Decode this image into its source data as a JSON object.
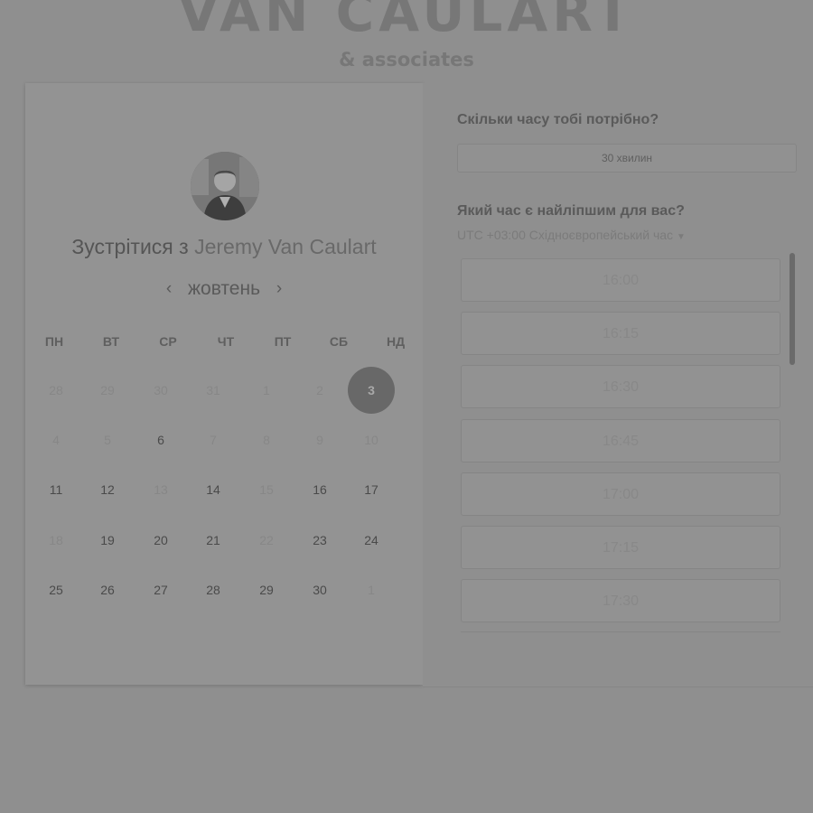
{
  "brand": {
    "title": "VAN CAULART",
    "subtitle": "& associates"
  },
  "meeting": {
    "prefix": "Зустрітися з",
    "name": "Jeremy Van Caulart"
  },
  "calendar": {
    "month": "жовтень",
    "weekdays": [
      "ПН",
      "ВТ",
      "СР",
      "ЧТ",
      "ПТ",
      "СБ",
      "НД"
    ],
    "weeks": [
      [
        {
          "d": "28",
          "s": "u"
        },
        {
          "d": "29",
          "s": "u"
        },
        {
          "d": "30",
          "s": "u"
        },
        {
          "d": "31",
          "s": "u"
        },
        {
          "d": "1",
          "s": "u"
        },
        {
          "d": "2",
          "s": "u"
        },
        {
          "d": "3",
          "s": "sel"
        }
      ],
      [
        {
          "d": "4",
          "s": "u"
        },
        {
          "d": "5",
          "s": "u"
        },
        {
          "d": "6",
          "s": "a"
        },
        {
          "d": "7",
          "s": "u"
        },
        {
          "d": "8",
          "s": "u"
        },
        {
          "d": "9",
          "s": "u"
        },
        {
          "d": "10",
          "s": "u"
        }
      ],
      [
        {
          "d": "11",
          "s": "a"
        },
        {
          "d": "12",
          "s": "a"
        },
        {
          "d": "13",
          "s": "u"
        },
        {
          "d": "14",
          "s": "a"
        },
        {
          "d": "15",
          "s": "u"
        },
        {
          "d": "16",
          "s": "a"
        },
        {
          "d": "17",
          "s": "a"
        }
      ],
      [
        {
          "d": "18",
          "s": "u"
        },
        {
          "d": "19",
          "s": "a"
        },
        {
          "d": "20",
          "s": "a"
        },
        {
          "d": "21",
          "s": "a"
        },
        {
          "d": "22",
          "s": "u"
        },
        {
          "d": "23",
          "s": "a"
        },
        {
          "d": "24",
          "s": "a"
        }
      ],
      [
        {
          "d": "25",
          "s": "a"
        },
        {
          "d": "26",
          "s": "a"
        },
        {
          "d": "27",
          "s": "a"
        },
        {
          "d": "28",
          "s": "a"
        },
        {
          "d": "29",
          "s": "a"
        },
        {
          "d": "30",
          "s": "a"
        },
        {
          "d": "1",
          "s": "u"
        }
      ]
    ]
  },
  "booking": {
    "duration_question": "Скільки часу тобі потрібно?",
    "duration_value": "30 хвилин",
    "time_question": "Який час є найліпшим для вас?",
    "timezone": "UTC +03:00 Східноєвропейський час",
    "slots": [
      "16:00",
      "16:15",
      "16:30",
      "16:45",
      "17:00",
      "17:15",
      "17:30"
    ]
  }
}
